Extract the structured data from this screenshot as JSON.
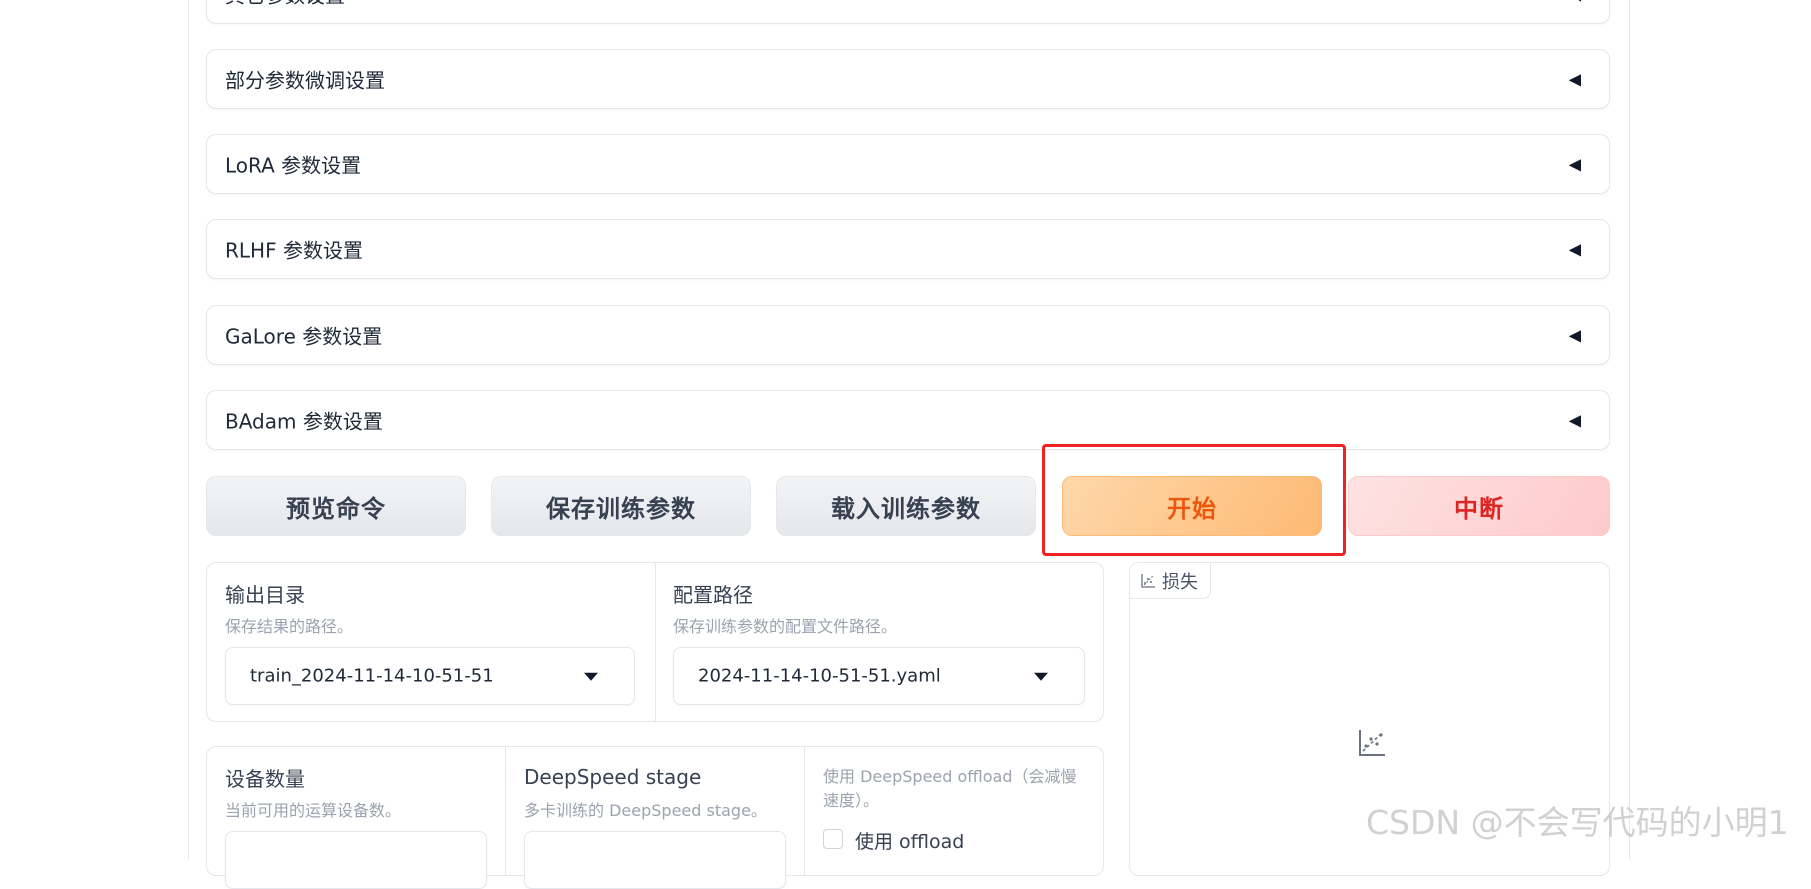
{
  "accordions": [
    {
      "title": "其它参数设置"
    },
    {
      "title": "部分参数微调设置"
    },
    {
      "title": "LoRA 参数设置"
    },
    {
      "title": "RLHF 参数设置"
    },
    {
      "title": "GaLore 参数设置"
    },
    {
      "title": "BAdam 参数设置"
    }
  ],
  "caret_glyph": "◀",
  "buttons": {
    "preview": "预览命令",
    "save": "保存训练参数",
    "load": "载入训练参数",
    "start": "开始",
    "stop": "中断"
  },
  "output_dir": {
    "label": "输出目录",
    "info": "保存结果的路径。",
    "value": "train_2024-11-14-10-51-51"
  },
  "config_path": {
    "label": "配置路径",
    "info": "保存训练参数的配置文件路径。",
    "value": "2024-11-14-10-51-51.yaml"
  },
  "device_count": {
    "label": "设备数量",
    "info": "当前可用的运算设备数。"
  },
  "ds_stage": {
    "label": "DeepSpeed stage",
    "info": "多卡训练的 DeepSpeed stage。"
  },
  "ds_offload": {
    "info_line1": "使用 DeepSpeed offload（会减慢",
    "info_line2": "速度）。",
    "checkbox_label": "使用 offload"
  },
  "loss_plot": {
    "label": "损失"
  },
  "watermark": "CSDN @不会写代码的小明1",
  "colors": {
    "start_text": "#ea580c",
    "stop_text": "#dc2626",
    "highlight": "#ef2222"
  }
}
